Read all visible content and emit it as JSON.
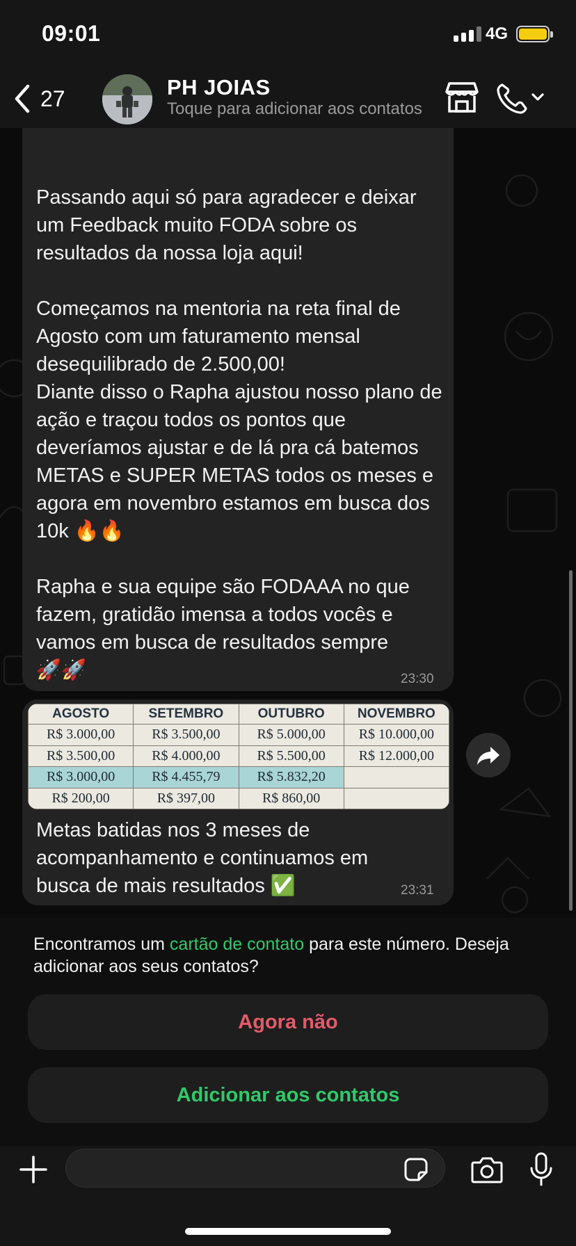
{
  "status_bar": {
    "time": "09:01",
    "network": "4G",
    "battery_color": "#f5cd0f"
  },
  "header": {
    "back_count": "27",
    "contact_name": "PH JOIAS",
    "subtitle": "Toque para adicionar aos contatos",
    "icons": [
      "chevron-left-icon",
      "store-icon",
      "phone-icon",
      "chevron-down-icon"
    ]
  },
  "messages": [
    {
      "text": "Passando aqui só para agradecer e deixar um Feedback muito FODA sobre os resultados da nossa loja aqui!\n\nComeçamos na mentoria na reta final de Agosto com um faturamento mensal desequilibrado de 2.500,00!\nDiante disso o Rapha ajustou nosso plano de ação e traçou todos os pontos que deveríamos ajustar e de lá pra cá batemos METAS e SUPER METAS todos os meses e agora em novembro estamos em busca dos 10k 🔥🔥\n\nRapha e sua equipe são FODAAA no que fazem, gratidão imensa a todos vocês e vamos em busca de resultados sempre\n🚀🚀",
      "time": "23:30"
    },
    {
      "image_table": {
        "headers": [
          "AGOSTO",
          "SETEMBRO",
          "OUTUBRO",
          "NOVEMBRO"
        ],
        "rows": [
          [
            "R$ 3.000,00",
            "R$ 3.500,00",
            "R$ 5.000,00",
            "R$ 10.000,00"
          ],
          [
            "R$ 3.500,00",
            "R$ 4.000,00",
            "R$ 5.500,00",
            "R$ 12.000,00"
          ],
          [
            "R$ 3.000,00",
            "R$ 4.455,79",
            "R$ 5.832,20",
            ""
          ],
          [
            "R$ 200,00",
            "R$ 397,00",
            "R$ 860,00",
            ""
          ]
        ]
      },
      "caption": "Metas batidas nos 3 meses de acompanhamento e continuamos em busca de mais resultados ✅",
      "time": "23:31"
    }
  ],
  "contact_card": {
    "prefix": "Encontramos um ",
    "link": "cartão de contato",
    "suffix": " para este número. Deseja adicionar aos seus contatos?",
    "decline_label": "Agora não",
    "add_label": "Adicionar aos contatos",
    "accent_green": "#2fca6a",
    "accent_red": "#e35b69"
  },
  "input_bar": {
    "placeholder": ""
  }
}
